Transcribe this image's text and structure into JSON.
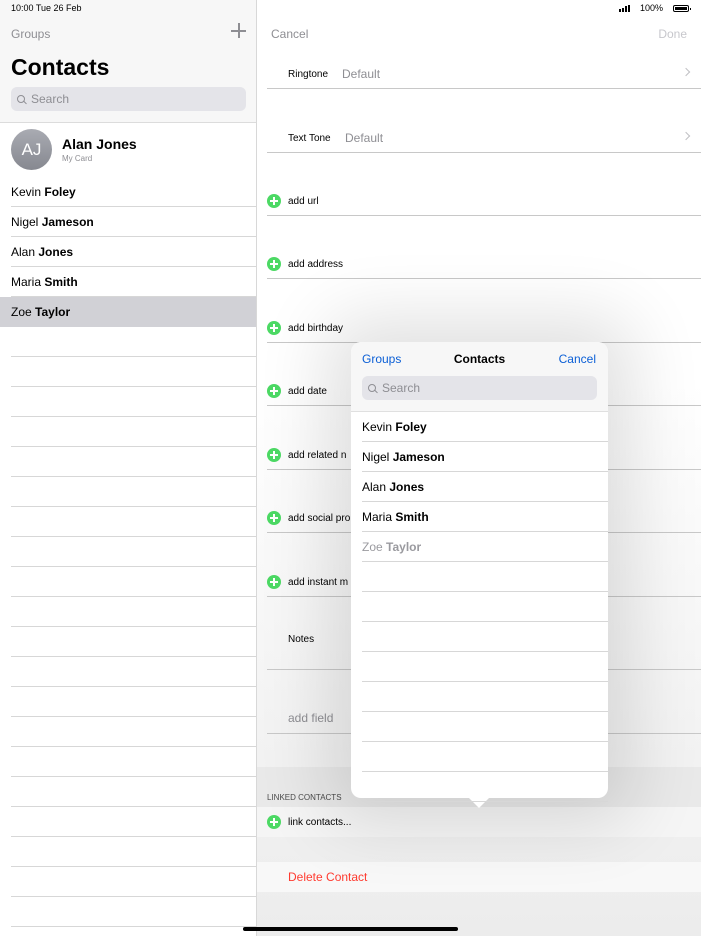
{
  "status_bar": {
    "time_date": "10:00  Tue 26 Feb",
    "battery": "100%"
  },
  "left": {
    "groups_label": "Groups",
    "title": "Contacts",
    "search_placeholder": "Search",
    "my_card": {
      "initials": "AJ",
      "name": "Alan Jones",
      "subtitle": "My Card"
    },
    "contacts": [
      {
        "first": "Kevin",
        "last": "Foley"
      },
      {
        "first": "Nigel",
        "last": "Jameson"
      },
      {
        "first": "Alan",
        "last": "Jones"
      },
      {
        "first": "Maria",
        "last": "Smith"
      },
      {
        "first": "Zoe",
        "last": "Taylor"
      }
    ]
  },
  "right": {
    "cancel_label": "Cancel",
    "done_label": "Done",
    "ringtone": {
      "label": "Ringtone",
      "value": "Default"
    },
    "text_tone": {
      "label": "Text Tone",
      "value": "Default"
    },
    "add_url": "add url",
    "add_address": "add address",
    "add_birthday": "add birthday",
    "add_date": "add date",
    "add_related": "add related n",
    "add_social": "add social pro",
    "add_instant": "add instant m",
    "notes_label": "Notes",
    "add_field": "add field",
    "linked_header": "LINKED CONTACTS",
    "link_contacts": "link contacts...",
    "delete_contact": "Delete Contact"
  },
  "popover": {
    "groups_label": "Groups",
    "title": "Contacts",
    "cancel_label": "Cancel",
    "search_placeholder": "Search",
    "contacts": [
      {
        "first": "Kevin",
        "last": "Foley"
      },
      {
        "first": "Nigel",
        "last": "Jameson"
      },
      {
        "first": "Alan",
        "last": "Jones"
      },
      {
        "first": "Maria",
        "last": "Smith"
      },
      {
        "first": "Zoe",
        "last": "Taylor"
      }
    ]
  },
  "colors": {
    "accent_blue": "#0b5fd6",
    "add_green": "#4cd964",
    "destructive_red": "#ff3b30"
  }
}
